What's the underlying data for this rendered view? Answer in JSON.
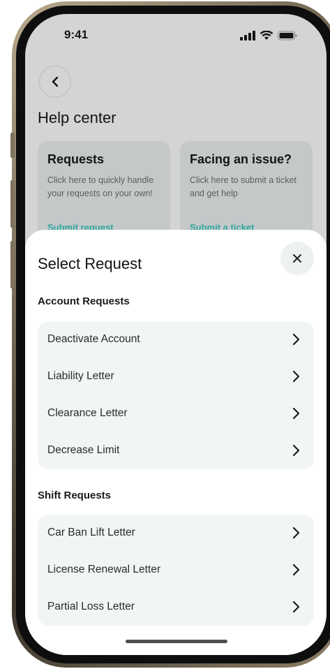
{
  "status_bar": {
    "time": "9:41"
  },
  "header": {
    "title": "Help center"
  },
  "cards": [
    {
      "title": "Requests",
      "description": "Click here to quickly handle your requests on your own!",
      "link": "Submit request"
    },
    {
      "title": "Facing an issue?",
      "description": "Click here to submit a ticket and get help",
      "link": "Submit a ticket"
    }
  ],
  "sheet": {
    "title": "Select Request",
    "sections": [
      {
        "title": "Account Requests",
        "items": [
          "Deactivate Account",
          "Liability Letter",
          "Clearance Letter",
          "Decrease Limit"
        ]
      },
      {
        "title": "Shift Requests",
        "items": [
          "Car Ban Lift Letter",
          "License Renewal Letter",
          "Partial Loss Letter"
        ]
      }
    ]
  },
  "icons": {
    "back": "chevron-left-icon",
    "close": "close-icon",
    "row": "chevron-right-icon",
    "signal": "signal-icon",
    "wifi": "wifi-icon",
    "battery": "battery-icon"
  },
  "colors": {
    "accent": "#2fa69c",
    "overlay": "#d4d4d4",
    "card": "#c5c8c9",
    "group": "#f2f5f6"
  }
}
